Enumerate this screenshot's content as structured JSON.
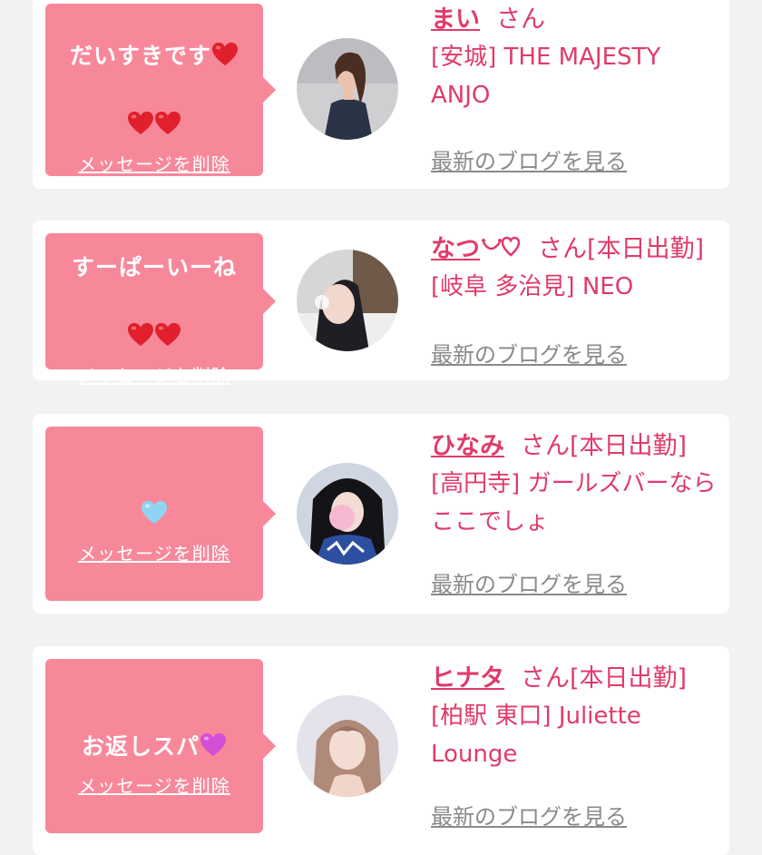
{
  "colors": {
    "page_bg": "#f2f2f4",
    "bubble_bg": "#f7889a",
    "accent_text": "#e03b6a",
    "blog_link": "#8a8a8a",
    "red_heart": "#e0202c",
    "blue_heart": "#8fd4f2",
    "pink_heart": "#d44fd6"
  },
  "delete_label": "メッセージを削除",
  "blog_label": "最新のブログを見る",
  "messages": [
    {
      "text": "だいすきです",
      "hearts": "red-heart-icon x3",
      "name": "まい",
      "honorific": "さん",
      "status": "",
      "shop": "[安城] THE MAJESTY ANJO"
    },
    {
      "text": "すーぱーいーね",
      "hearts": "red-heart-icon x2",
      "name": "なつ",
      "name_suffix_icon": "smile-heart-icon",
      "honorific": "さん",
      "status": "[本日出勤]",
      "shop": "[岐阜 多治見] NEO"
    },
    {
      "text": "",
      "hearts": "blue-heart-icon x1",
      "name": "ひなみ",
      "honorific": "さん",
      "status": "[本日出勤]",
      "shop": "[高円寺] ガールズバーならここでしょ"
    },
    {
      "text": "お返しスパ",
      "hearts": "pink-heart-icon x1",
      "name": "ヒナタ",
      "honorific": "さん",
      "status": "[本日出勤]",
      "shop": "[柏駅 東口] Juliette Lounge"
    }
  ]
}
